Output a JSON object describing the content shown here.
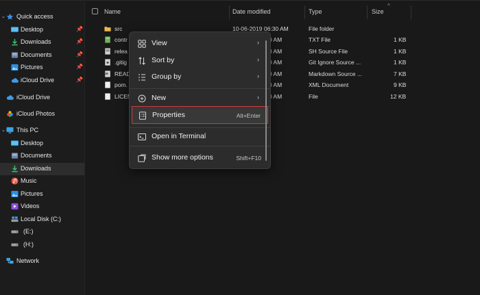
{
  "sidebar": {
    "quick_access": "Quick access",
    "quick_items": [
      {
        "label": "Desktop",
        "icon": "desktop-icon",
        "pinned": true
      },
      {
        "label": "Downloads",
        "icon": "download-icon",
        "pinned": true
      },
      {
        "label": "Documents",
        "icon": "document-icon",
        "pinned": true
      },
      {
        "label": "Pictures",
        "icon": "picture-icon",
        "pinned": true
      },
      {
        "label": "iCloud Drive",
        "icon": "icloud-icon",
        "pinned": true
      }
    ],
    "icloud_drive": "iCloud Drive",
    "icloud_photos": "iCloud Photos",
    "this_pc": "This PC",
    "pc_items": [
      {
        "label": "Desktop",
        "icon": "desktop-icon"
      },
      {
        "label": "Documents",
        "icon": "document-icon"
      },
      {
        "label": "Downloads",
        "icon": "download-icon",
        "active": true
      },
      {
        "label": "Music",
        "icon": "music-icon"
      },
      {
        "label": "Pictures",
        "icon": "picture-icon"
      },
      {
        "label": "Videos",
        "icon": "video-icon"
      },
      {
        "label": "Local Disk (C:)",
        "icon": "disk-icon"
      },
      {
        "label": "(E:)",
        "icon": "drive-icon"
      },
      {
        "label": "(H:)",
        "icon": "drive-icon"
      }
    ],
    "network": "Network"
  },
  "columns": {
    "name": "Name",
    "date": "Date modified",
    "type": "Type",
    "size": "Size"
  },
  "files": [
    {
      "name": "src",
      "date": "10-06-2019 06:30 AM",
      "type": "File folder",
      "size": "",
      "icon": "folder-icon"
    },
    {
      "name": "contr",
      "date": "6:30 AM",
      "type": "TXT File",
      "size": "1 KB",
      "icon": "text-file-icon"
    },
    {
      "name": "relea",
      "date": "6:30 AM",
      "type": "SH Source File",
      "size": "1 KB",
      "icon": "script-file-icon"
    },
    {
      "name": ".gitig",
      "date": "6:30 AM",
      "type": "Git Ignore Source ...",
      "size": "1 KB",
      "icon": "git-file-icon"
    },
    {
      "name": "READ",
      "date": "6:30 AM",
      "type": "Markdown Source ...",
      "size": "7 KB",
      "icon": "markdown-file-icon"
    },
    {
      "name": "pom.",
      "date": "6:30 AM",
      "type": "XML Document",
      "size": "9 KB",
      "icon": "xml-file-icon"
    },
    {
      "name": "LICEN",
      "date": "6:30 AM",
      "type": "File",
      "size": "12 KB",
      "icon": "file-icon"
    }
  ],
  "context_menu": {
    "view": "View",
    "sort_by": "Sort by",
    "group_by": "Group by",
    "new": "New",
    "properties": "Properties",
    "properties_shortcut": "Alt+Enter",
    "open_terminal": "Open in Terminal",
    "more_options": "Show more options",
    "more_options_shortcut": "Shift+F10",
    "highlight_color": "#d33a3a"
  }
}
